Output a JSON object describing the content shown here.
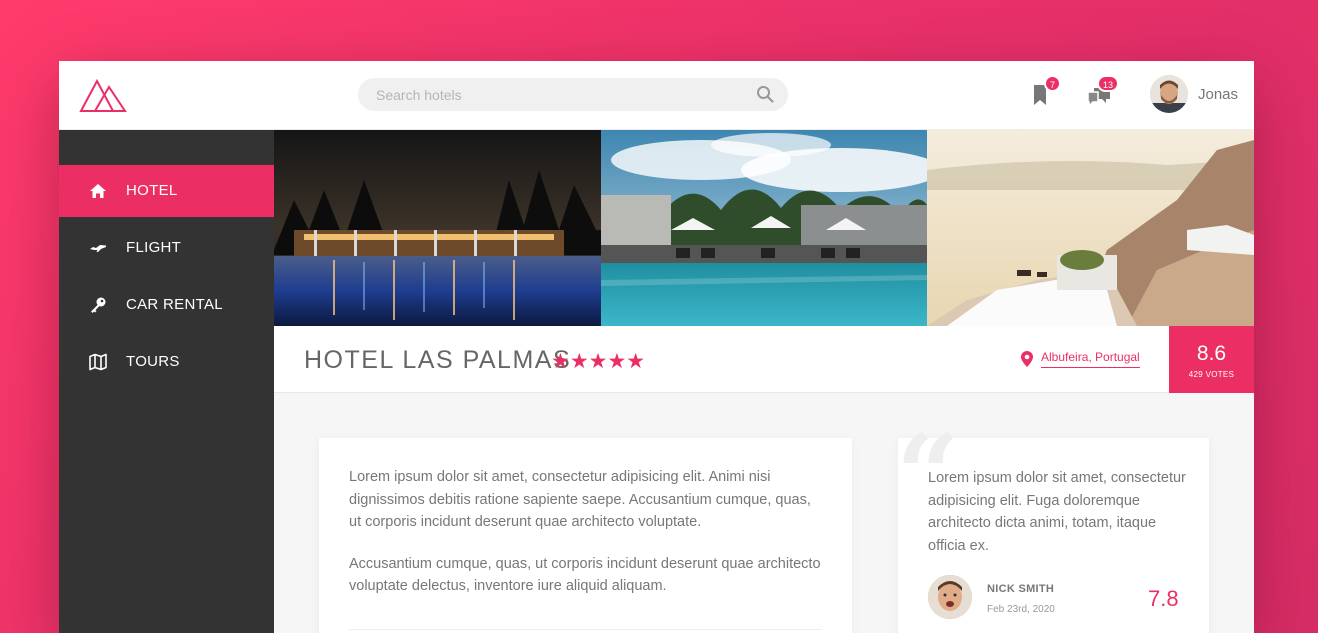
{
  "header": {
    "search_placeholder": "Search hotels",
    "bookmarks_count": "7",
    "messages_count": "13",
    "user_name": "Jonas"
  },
  "sidebar": {
    "items": [
      {
        "label": "HOTEL",
        "icon": "home-icon",
        "active": true
      },
      {
        "label": "FLIGHT",
        "icon": "plane-icon",
        "active": false
      },
      {
        "label": "CAR RENTAL",
        "icon": "key-icon",
        "active": false
      },
      {
        "label": "TOURS",
        "icon": "map-icon",
        "active": false
      }
    ]
  },
  "overview": {
    "hotel_name": "HOTEL LAS PALMAS",
    "stars": "★★★★★",
    "star_count": 5,
    "location": "Albufeira, Portugal",
    "rating": "8.6",
    "votes": "429 VOTES"
  },
  "description": {
    "paragraphs": [
      "Lorem ipsum dolor sit amet, consectetur adipisicing elit. Animi nisi dignissimos debitis ratione sapiente saepe. Accusantium cumque, quas, ut corporis incidunt deserunt quae architecto voluptate.",
      "Accusantium cumque, quas, ut corporis incidunt deserunt quae architecto voluptate delectus, inventore iure aliquid aliquam."
    ]
  },
  "review": {
    "text": "Lorem ipsum dolor sit amet, consectetur adipisicing elit. Fuga doloremque architecto dicta animi, totam, itaque officia ex.",
    "author": "NICK SMITH",
    "date": "Feb 23rd, 2020",
    "score": "7.8"
  },
  "colors": {
    "accent": "#eb2f64",
    "sidebar": "#333333",
    "background_gradient_start": "#ff3b6b",
    "background_gradient_end": "#d72d66"
  }
}
